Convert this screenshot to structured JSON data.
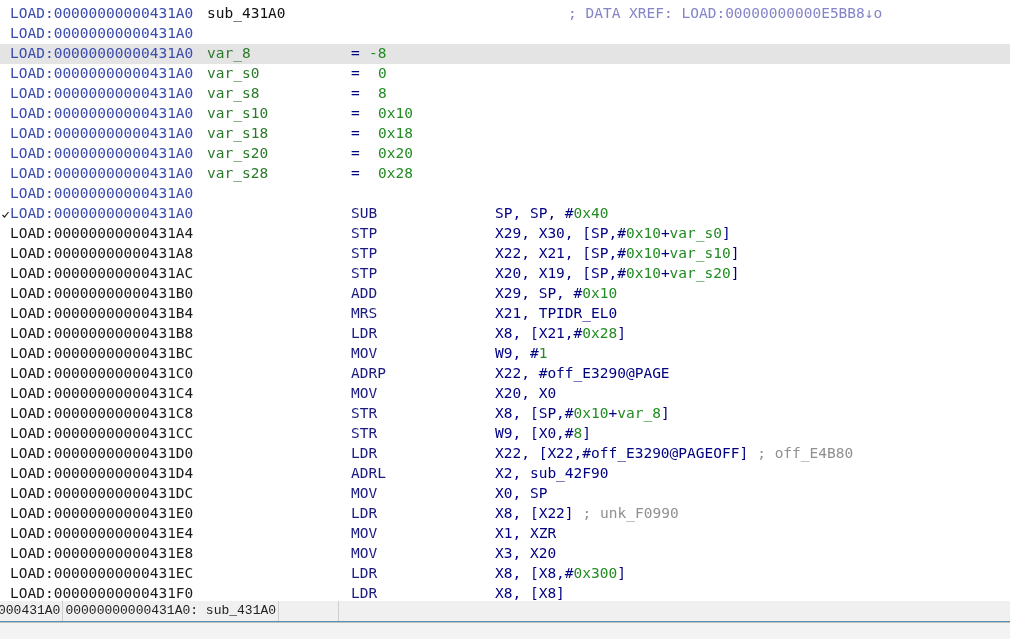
{
  "listing": [
    {
      "kind": "label",
      "address": "LOAD:00000000000431A0",
      "header": true,
      "selected": false,
      "checked": false,
      "label": "sub_431A0",
      "comment": "; DATA XREF: LOAD:00000000000E5BB8↓o"
    },
    {
      "kind": "empty",
      "address": "LOAD:00000000000431A0",
      "header": true,
      "selected": false,
      "checked": false
    },
    {
      "kind": "var",
      "address": "LOAD:00000000000431A0",
      "header": true,
      "selected": true,
      "checked": false,
      "label": "var_8",
      "op": "=",
      "value": "-8"
    },
    {
      "kind": "var",
      "address": "LOAD:00000000000431A0",
      "header": true,
      "selected": false,
      "checked": false,
      "label": "var_s0",
      "op": "=",
      "value": "0"
    },
    {
      "kind": "var",
      "address": "LOAD:00000000000431A0",
      "header": true,
      "selected": false,
      "checked": false,
      "label": "var_s8",
      "op": "=",
      "value": "8"
    },
    {
      "kind": "var",
      "address": "LOAD:00000000000431A0",
      "header": true,
      "selected": false,
      "checked": false,
      "label": "var_s10",
      "op": "=",
      "value": "0x10"
    },
    {
      "kind": "var",
      "address": "LOAD:00000000000431A0",
      "header": true,
      "selected": false,
      "checked": false,
      "label": "var_s18",
      "op": "=",
      "value": "0x18"
    },
    {
      "kind": "var",
      "address": "LOAD:00000000000431A0",
      "header": true,
      "selected": false,
      "checked": false,
      "label": "var_s20",
      "op": "=",
      "value": "0x20"
    },
    {
      "kind": "var",
      "address": "LOAD:00000000000431A0",
      "header": true,
      "selected": false,
      "checked": false,
      "label": "var_s28",
      "op": "=",
      "value": "0x28"
    },
    {
      "kind": "empty",
      "address": "LOAD:00000000000431A0",
      "header": true,
      "selected": false,
      "checked": false
    },
    {
      "kind": "insn",
      "address": "LOAD:00000000000431A0",
      "header": true,
      "selected": false,
      "checked": true,
      "mnemonic": "SUB",
      "operands": [
        {
          "kind": "plain",
          "text": "SP, SP, #"
        },
        {
          "kind": "num",
          "text": "0x40"
        }
      ]
    },
    {
      "kind": "insn",
      "address": "LOAD:00000000000431A4",
      "header": false,
      "selected": false,
      "checked": false,
      "mnemonic": "STP",
      "operands": [
        {
          "kind": "plain",
          "text": "X29, X30, [SP,#"
        },
        {
          "kind": "num",
          "text": "0x10"
        },
        {
          "kind": "plain",
          "text": "+"
        },
        {
          "kind": "num",
          "text": "var_s0"
        },
        {
          "kind": "plain",
          "text": "]"
        }
      ]
    },
    {
      "kind": "insn",
      "address": "LOAD:00000000000431A8",
      "header": false,
      "selected": false,
      "checked": false,
      "mnemonic": "STP",
      "operands": [
        {
          "kind": "plain",
          "text": "X22, X21, [SP,#"
        },
        {
          "kind": "num",
          "text": "0x10"
        },
        {
          "kind": "plain",
          "text": "+"
        },
        {
          "kind": "num",
          "text": "var_s10"
        },
        {
          "kind": "plain",
          "text": "]"
        }
      ]
    },
    {
      "kind": "insn",
      "address": "LOAD:00000000000431AC",
      "header": false,
      "selected": false,
      "checked": false,
      "mnemonic": "STP",
      "operands": [
        {
          "kind": "plain",
          "text": "X20, X19, [SP,#"
        },
        {
          "kind": "num",
          "text": "0x10"
        },
        {
          "kind": "plain",
          "text": "+"
        },
        {
          "kind": "num",
          "text": "var_s20"
        },
        {
          "kind": "plain",
          "text": "]"
        }
      ]
    },
    {
      "kind": "insn",
      "address": "LOAD:00000000000431B0",
      "header": false,
      "selected": false,
      "checked": false,
      "mnemonic": "ADD",
      "operands": [
        {
          "kind": "plain",
          "text": "X29, SP, #"
        },
        {
          "kind": "num",
          "text": "0x10"
        }
      ]
    },
    {
      "kind": "insn",
      "address": "LOAD:00000000000431B4",
      "header": false,
      "selected": false,
      "checked": false,
      "mnemonic": "MRS",
      "operands": [
        {
          "kind": "plain",
          "text": "X21, TPIDR_EL0"
        }
      ]
    },
    {
      "kind": "insn",
      "address": "LOAD:00000000000431B8",
      "header": false,
      "selected": false,
      "checked": false,
      "mnemonic": "LDR",
      "operands": [
        {
          "kind": "plain",
          "text": "X8, [X21,#"
        },
        {
          "kind": "num",
          "text": "0x28"
        },
        {
          "kind": "plain",
          "text": "]"
        }
      ]
    },
    {
      "kind": "insn",
      "address": "LOAD:00000000000431BC",
      "header": false,
      "selected": false,
      "checked": false,
      "mnemonic": "MOV",
      "operands": [
        {
          "kind": "plain",
          "text": "W9, #"
        },
        {
          "kind": "num",
          "text": "1"
        }
      ]
    },
    {
      "kind": "insn",
      "address": "LOAD:00000000000431C0",
      "header": false,
      "selected": false,
      "checked": false,
      "mnemonic": "ADRP",
      "operands": [
        {
          "kind": "plain",
          "text": "X22, #off_E3290@PAGE"
        }
      ]
    },
    {
      "kind": "insn",
      "address": "LOAD:00000000000431C4",
      "header": false,
      "selected": false,
      "checked": false,
      "mnemonic": "MOV",
      "operands": [
        {
          "kind": "plain",
          "text": "X20, X0"
        }
      ]
    },
    {
      "kind": "insn",
      "address": "LOAD:00000000000431C8",
      "header": false,
      "selected": false,
      "checked": false,
      "mnemonic": "STR",
      "operands": [
        {
          "kind": "plain",
          "text": "X8, [SP,#"
        },
        {
          "kind": "num",
          "text": "0x10"
        },
        {
          "kind": "plain",
          "text": "+"
        },
        {
          "kind": "num",
          "text": "var_8"
        },
        {
          "kind": "plain",
          "text": "]"
        }
      ]
    },
    {
      "kind": "insn",
      "address": "LOAD:00000000000431CC",
      "header": false,
      "selected": false,
      "checked": false,
      "mnemonic": "STR",
      "operands": [
        {
          "kind": "plain",
          "text": "W9, [X0,#"
        },
        {
          "kind": "num",
          "text": "8"
        },
        {
          "kind": "plain",
          "text": "]"
        }
      ]
    },
    {
      "kind": "insn",
      "address": "LOAD:00000000000431D0",
      "header": false,
      "selected": false,
      "checked": false,
      "mnemonic": "LDR",
      "operands": [
        {
          "kind": "plain",
          "text": "X22, [X22,#off_E3290@PAGEOFF]"
        },
        {
          "kind": "comment",
          "text": "; off_E4B80"
        }
      ]
    },
    {
      "kind": "insn",
      "address": "LOAD:00000000000431D4",
      "header": false,
      "selected": false,
      "checked": false,
      "mnemonic": "ADRL",
      "operands": [
        {
          "kind": "plain",
          "text": "X2, sub_42F90"
        }
      ]
    },
    {
      "kind": "insn",
      "address": "LOAD:00000000000431DC",
      "header": false,
      "selected": false,
      "checked": false,
      "mnemonic": "MOV",
      "operands": [
        {
          "kind": "plain",
          "text": "X0, SP"
        }
      ]
    },
    {
      "kind": "insn",
      "address": "LOAD:00000000000431E0",
      "header": false,
      "selected": false,
      "checked": false,
      "mnemonic": "LDR",
      "operands": [
        {
          "kind": "plain",
          "text": "X8, [X22]"
        },
        {
          "kind": "comment",
          "text": "; unk_F0990"
        }
      ]
    },
    {
      "kind": "insn",
      "address": "LOAD:00000000000431E4",
      "header": false,
      "selected": false,
      "checked": false,
      "mnemonic": "MOV",
      "operands": [
        {
          "kind": "plain",
          "text": "X1, XZR"
        }
      ]
    },
    {
      "kind": "insn",
      "address": "LOAD:00000000000431E8",
      "header": false,
      "selected": false,
      "checked": false,
      "mnemonic": "MOV",
      "operands": [
        {
          "kind": "plain",
          "text": "X3, X20"
        }
      ]
    },
    {
      "kind": "insn",
      "address": "LOAD:00000000000431EC",
      "header": false,
      "selected": false,
      "checked": false,
      "mnemonic": "LDR",
      "operands": [
        {
          "kind": "plain",
          "text": "X8, [X8,#"
        },
        {
          "kind": "num",
          "text": "0x300"
        },
        {
          "kind": "plain",
          "text": "]"
        }
      ]
    },
    {
      "kind": "insn",
      "address": "LOAD:00000000000431F0",
      "header": false,
      "selected": false,
      "checked": false,
      "mnemonic": "LDR",
      "operands": [
        {
          "kind": "plain",
          "text": "X8, [X8]"
        }
      ]
    }
  ],
  "status_bar": [
    "000431A0",
    "00000000000431A0: sub_431A0"
  ]
}
